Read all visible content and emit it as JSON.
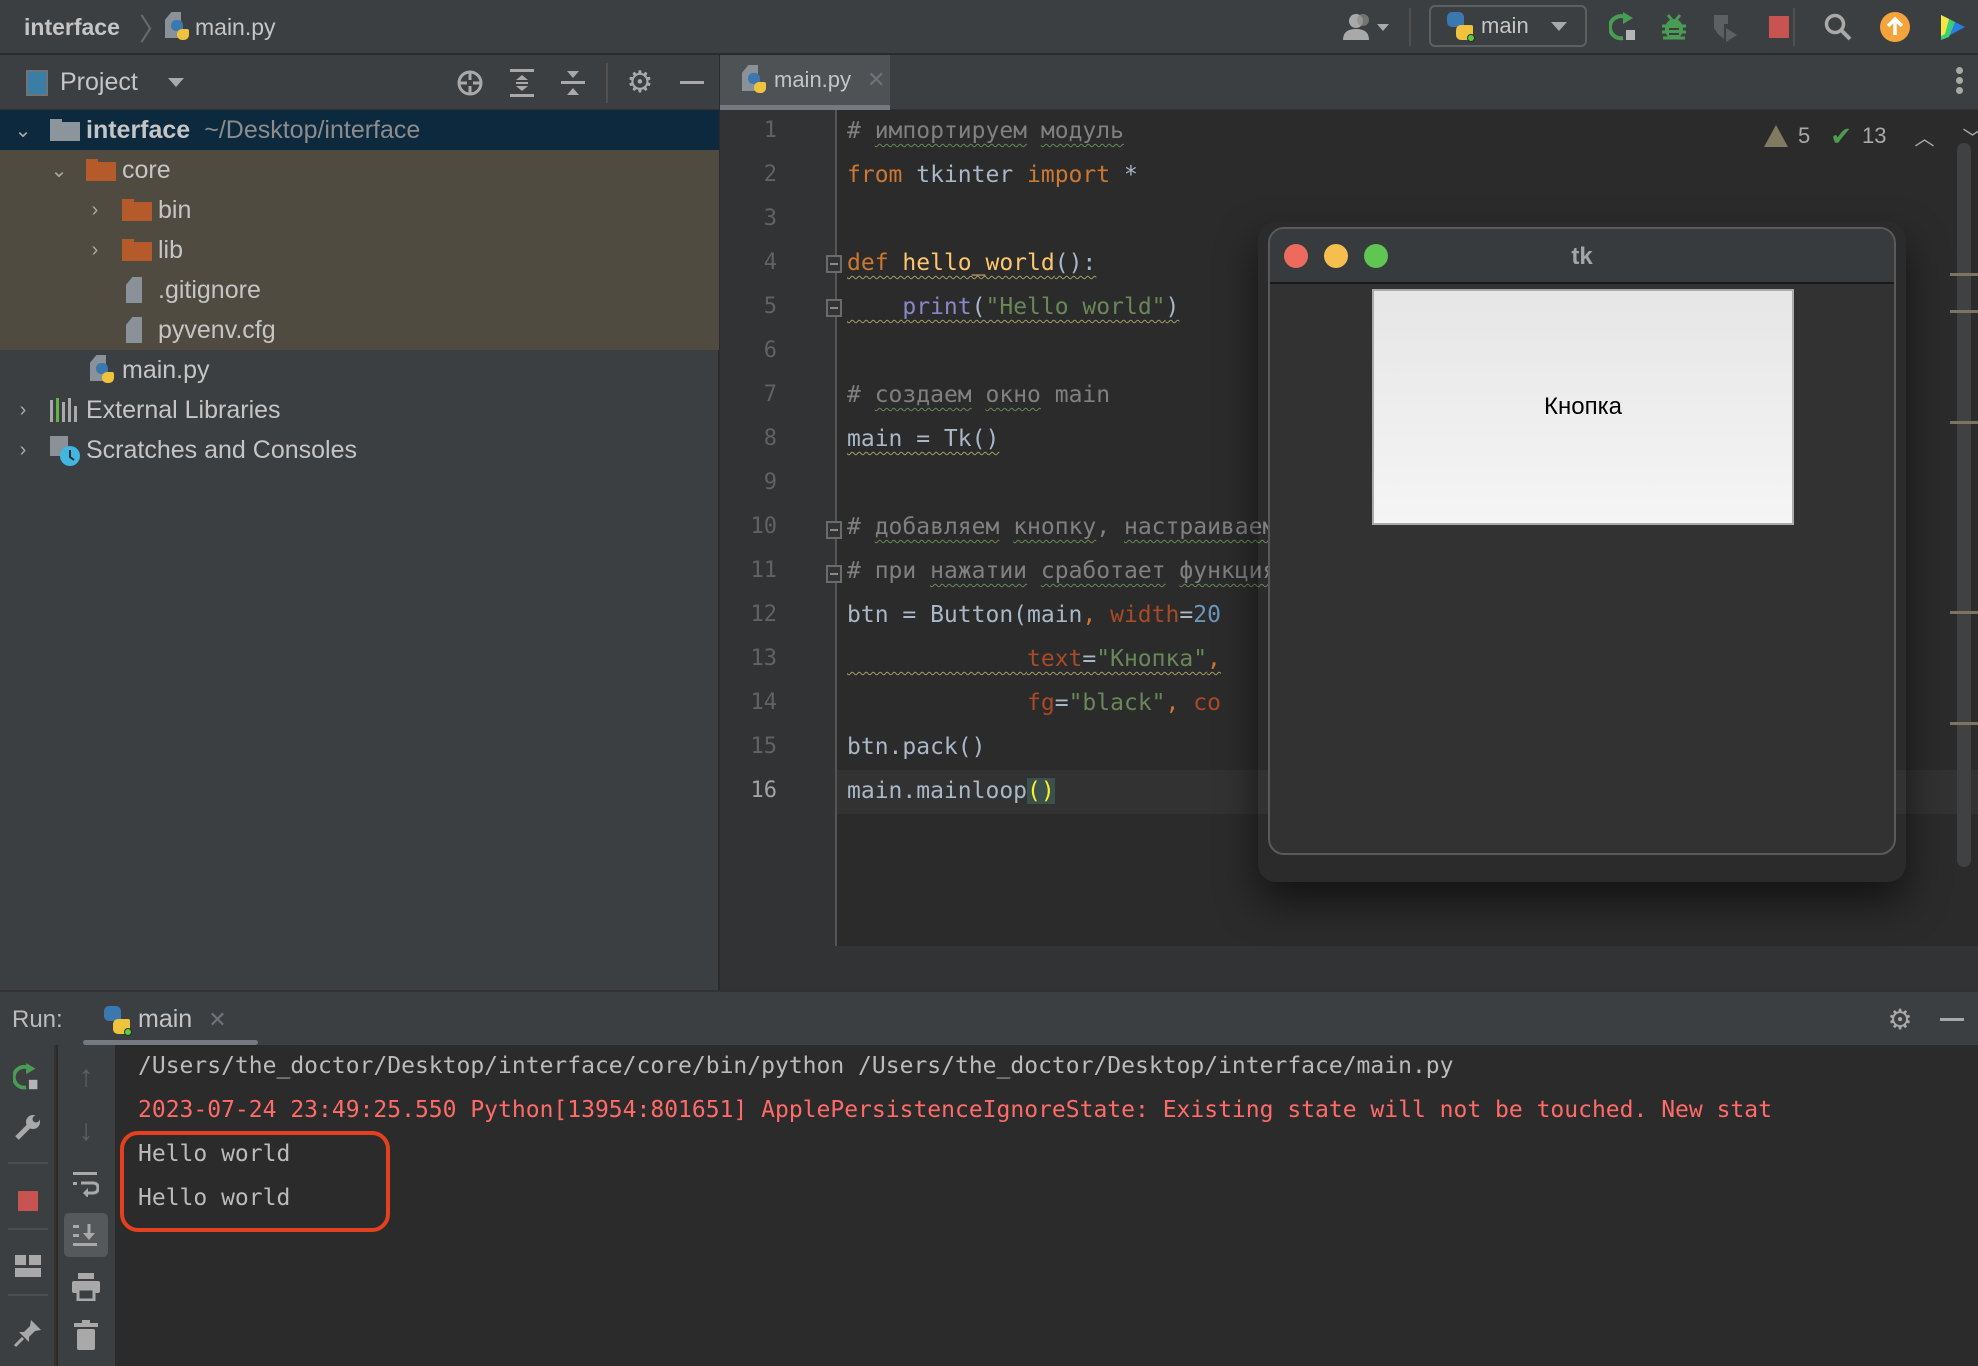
{
  "navbar": {
    "project_name": "interface",
    "separator": "〉",
    "file_name": "main.py",
    "run_config": "main",
    "icons": [
      "vcs-users-icon",
      "rerun-icon",
      "debug-icon",
      "coverage-icon",
      "stop-icon",
      "search-icon",
      "update-icon",
      "toolbox-icon"
    ]
  },
  "project_panel": {
    "title": "Project",
    "tree": [
      {
        "label": "interface",
        "hint": "~/Desktop/interface",
        "type": "folder",
        "expanded": true,
        "selected": true
      },
      {
        "label": "core",
        "type": "excluded-folder",
        "expanded": true
      },
      {
        "label": "bin",
        "type": "excluded-folder",
        "expanded": false
      },
      {
        "label": "lib",
        "type": "excluded-folder",
        "expanded": false
      },
      {
        "label": ".gitignore",
        "type": "ignore-file"
      },
      {
        "label": "pyvenv.cfg",
        "type": "text-file"
      },
      {
        "label": "main.py",
        "type": "python-file"
      },
      {
        "label": "External Libraries",
        "type": "libraries",
        "expanded": false
      },
      {
        "label": "Scratches and Consoles",
        "type": "scratches",
        "expanded": false
      }
    ]
  },
  "editor": {
    "tab_label": "main.py",
    "inspections": {
      "warnings": "5",
      "weak_warnings": "13"
    },
    "current_line": 16,
    "line_numbers": [
      "1",
      "2",
      "3",
      "4",
      "5",
      "6",
      "7",
      "8",
      "9",
      "10",
      "11",
      "12",
      "13",
      "14",
      "15",
      "16"
    ],
    "lines": {
      "l1_hash": "# ",
      "l1_w1": "импортируем",
      "l1_w2": "модуль",
      "l2_from": "from",
      "l2_mod": " tkinter ",
      "l2_import": "import",
      "l2_star": " *",
      "l4_def": "def",
      "l4_name": "hello_world",
      "l4_rest": "():",
      "l5_indent": "    ",
      "l5_print": "print",
      "l5_open": "(",
      "l5_str": "\"Hello world\"",
      "l5_close": ")",
      "l7_hash": "# ",
      "l7_w1": "создаем",
      "l7_w2": "окно",
      "l7_w3": " main",
      "l8": "main = Tk()",
      "l10_hash": "# ",
      "l10_w1": "добавляем",
      "l10_w2": "кнопку",
      "l10_comma": ", ",
      "l10_w3": "настраиваем",
      "l11_hash": "# при ",
      "l11_w1": "нажатии",
      "l11_w2": "сработает",
      "l11_w3": "функция",
      "l12_a": "btn = Button(main",
      "l12_comma": ", ",
      "l12_param": "width",
      "l12_eq": "=",
      "l12_num": "20",
      "l13_indent": "             ",
      "l13_param": "text",
      "l13_eq": "=",
      "l13_str": "\"Кнопка\"",
      "l13_comma": ",",
      "l14_indent": "             ",
      "l14_param": "fg",
      "l14_eq": "=",
      "l14_str": "\"black\"",
      "l14_comma": ", ",
      "l14_param2": "co",
      "l15": "btn.pack()",
      "l16_a": "main.mainloop",
      "l16_paren": "()"
    }
  },
  "tk_window": {
    "title": "tk",
    "button_label": "Кнопка",
    "traffic_lights": {
      "close": "#ed6a5e",
      "minimize": "#f5bf4f",
      "zoom": "#61c554"
    }
  },
  "run_panel": {
    "label": "Run:",
    "tab_label": "main",
    "console": [
      {
        "text": "/Users/the_doctor/Desktop/interface/core/bin/python /Users/the_doctor/Desktop/interface/main.py",
        "kind": "command"
      },
      {
        "text": "2023-07-24 23:49:25.550 Python[13954:801651] ApplePersistenceIgnoreState: Existing state will not be touched. New stat",
        "kind": "stderr"
      },
      {
        "text": "Hello world",
        "kind": "stdout"
      },
      {
        "text": "Hello world",
        "kind": "stdout"
      }
    ],
    "annotation_color": "#e2401f"
  },
  "colors": {
    "accent_green": "#499c54",
    "stop_red": "#c75450",
    "update_orange": "#f4a43a",
    "error_text": "#ff6b68"
  }
}
